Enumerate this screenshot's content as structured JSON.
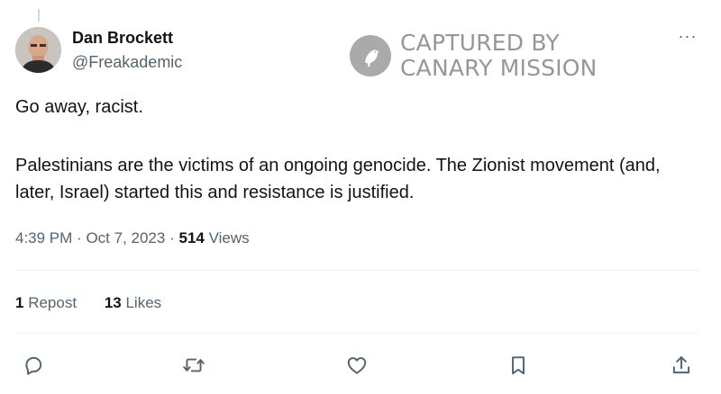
{
  "author": {
    "name": "Dan Brockett",
    "handle": "@Freakademic"
  },
  "watermark": {
    "line1": "CAPTURED BY",
    "line2": "CANARY MISSION"
  },
  "tweet": {
    "paragraphs": [
      "Go away, racist.",
      "Palestinians are the victims of an ongoing genocide. The Zionist movement (and, later, Israel) started this and resistance is justified."
    ]
  },
  "meta": {
    "time": "4:39 PM",
    "separator1": "·",
    "date": "Oct 7, 2023",
    "separator2": "·",
    "views_count": "514",
    "views_label": "Views"
  },
  "stats": {
    "reposts_count": "1",
    "reposts_label": "Repost",
    "likes_count": "13",
    "likes_label": "Likes"
  },
  "more_label": "···",
  "icons": {
    "reply": "reply-icon",
    "repost": "repost-icon",
    "like": "heart-icon",
    "bookmark": "bookmark-icon",
    "share": "share-icon"
  },
  "colors": {
    "text_primary": "#0f1419",
    "text_secondary": "#536471",
    "divider": "#eff3f4"
  }
}
